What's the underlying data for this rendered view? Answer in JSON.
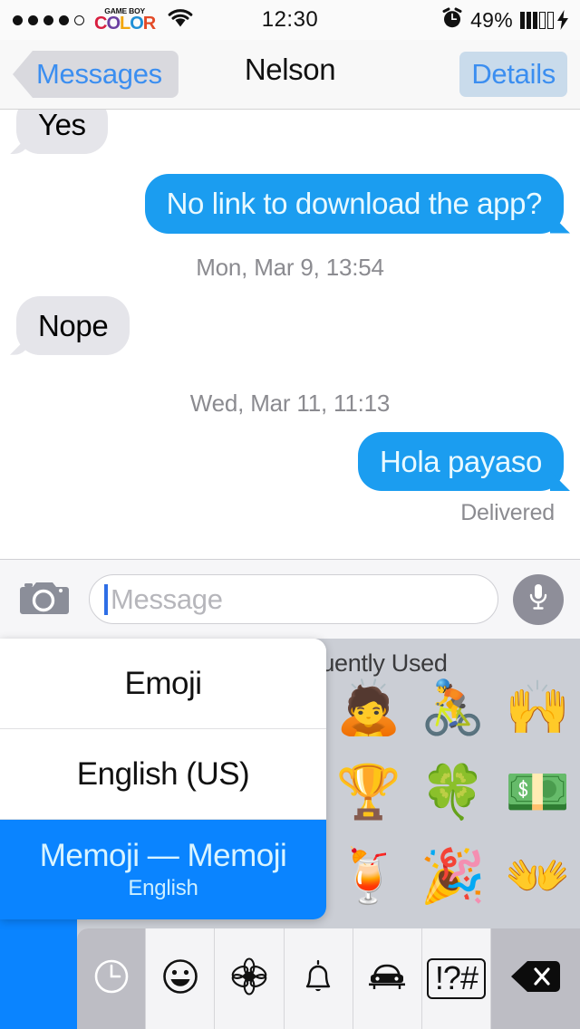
{
  "status_bar": {
    "signal_dots_filled": 4,
    "signal_dots_total": 5,
    "carrier_logo_top": "GAME BOY",
    "carrier_logo_letters": [
      "C",
      "O",
      "L",
      "O",
      "R"
    ],
    "wifi_icon": "wifi-icon",
    "time": "12:30",
    "alarm_icon": "alarm-clock-icon",
    "battery_percent": "49%",
    "battery_icon": "battery-charging-icon"
  },
  "nav_bar": {
    "back_label": "Messages",
    "title": "Nelson",
    "details_label": "Details"
  },
  "conversation": {
    "messages": [
      {
        "type": "bubble",
        "direction": "in",
        "text": "Yes"
      },
      {
        "type": "bubble",
        "direction": "out",
        "text": "No link to download the app?"
      },
      {
        "type": "timestamp",
        "text": "Mon, Mar 9, 13:54"
      },
      {
        "type": "bubble",
        "direction": "in",
        "text": "Nope"
      },
      {
        "type": "timestamp",
        "text": "Wed, Mar 11, 11:13"
      },
      {
        "type": "bubble",
        "direction": "out",
        "text": "Hola payaso"
      },
      {
        "type": "status",
        "text": "Delivered"
      }
    ],
    "bubble_color_out": "#1b9df0",
    "bubble_color_in": "#e5e5ea"
  },
  "input_toolbar": {
    "camera_icon": "camera-icon",
    "message_value": "",
    "message_placeholder": "Message",
    "mic_icon": "microphone-icon"
  },
  "emoji_keyboard": {
    "section_title": "Frequently Used",
    "emojis": [
      {
        "name": "person-bowing",
        "glyph": "🙇"
      },
      {
        "name": "cyclist",
        "glyph": "🚴"
      },
      {
        "name": "raising-hands",
        "glyph": "🙌"
      },
      {
        "name": "trophy",
        "glyph": "🏆"
      },
      {
        "name": "four-leaf-clover",
        "glyph": "🍀"
      },
      {
        "name": "dollar-banknotes",
        "glyph": "💵"
      },
      {
        "name": "tropical-drink",
        "glyph": "🍹"
      },
      {
        "name": "party-popper",
        "glyph": "🎉"
      },
      {
        "name": "open-hands",
        "glyph": "👐"
      }
    ],
    "categories": [
      {
        "name": "recents",
        "glyph": "🕐",
        "selected": true
      },
      {
        "name": "smileys",
        "glyph": "☺",
        "selected": false
      },
      {
        "name": "nature",
        "glyph": "✼",
        "selected": false
      },
      {
        "name": "objects",
        "glyph": "🔔",
        "selected": false
      },
      {
        "name": "travel",
        "glyph": "🚗",
        "selected": false
      },
      {
        "name": "symbols",
        "glyph": "!?#",
        "selected": false
      }
    ],
    "delete_key": "⌫"
  },
  "keyboard_selector": {
    "options": [
      {
        "label": "Emoji",
        "sub": "",
        "selected": false
      },
      {
        "label": "English (US)",
        "sub": "",
        "selected": false
      },
      {
        "label": "Memoji — Memoji",
        "sub": "English",
        "selected": true
      }
    ]
  }
}
